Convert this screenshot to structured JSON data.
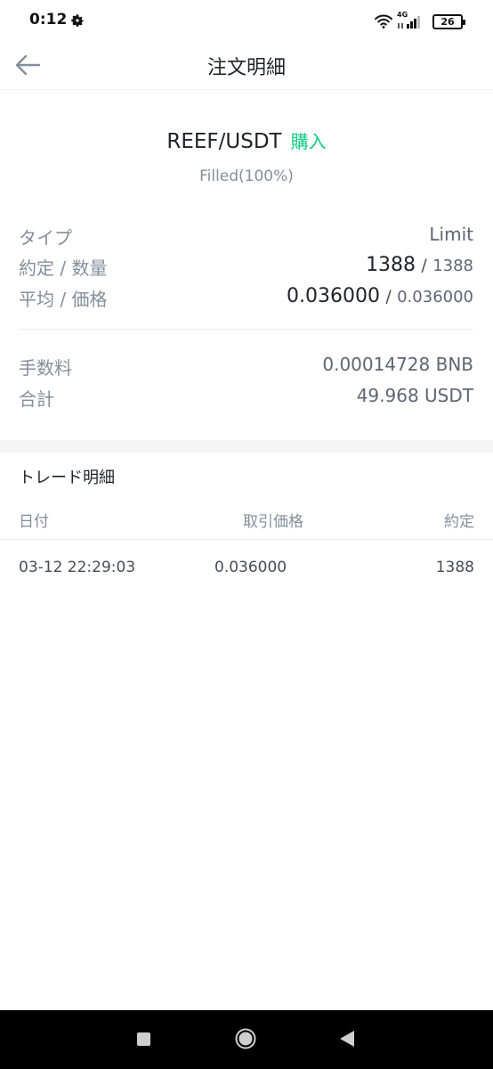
{
  "status_bar": {
    "time": "0:12",
    "network": "4G",
    "battery": "26"
  },
  "header": {
    "title": "注文明細"
  },
  "order": {
    "pair": "REEF/USDT",
    "side": "購入",
    "status": "Filled(100%)",
    "type_label": "タイプ",
    "type_value": "Limit",
    "filled_label": "約定 / 数量",
    "filled": "1388",
    "amount": "1388",
    "price_label": "平均 / 価格",
    "avg_price": "0.036000",
    "price": "0.036000",
    "separator": "/",
    "fee_label": "手数料",
    "fee_value": "0.00014728 BNB",
    "total_label": "合計",
    "total_value": "49.968 USDT"
  },
  "trades": {
    "title": "トレード明細",
    "columns": {
      "date": "日付",
      "price": "取引価格",
      "filled": "約定"
    },
    "rows": [
      {
        "date": "03-12 22:29:03",
        "price": "0.036000",
        "filled": "1388"
      }
    ]
  },
  "icons": {
    "back": "back-arrow-icon",
    "settings": "gear-icon",
    "wifi": "wifi-icon",
    "signal": "signal-icon",
    "battery": "battery-icon"
  },
  "colors": {
    "buy": "#0ecb81",
    "label": "#848e9c",
    "text": "#1e2329"
  }
}
